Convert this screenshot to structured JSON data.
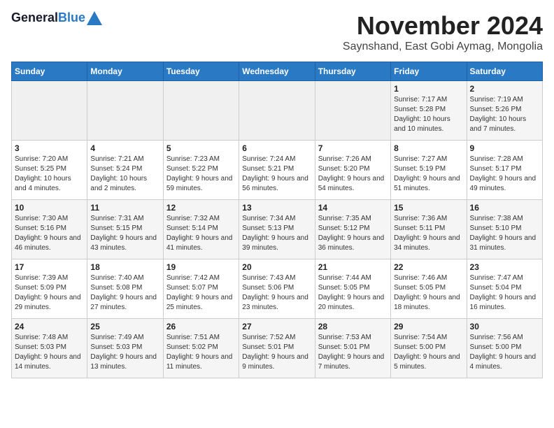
{
  "header": {
    "logo_line1": "General",
    "logo_line2": "Blue",
    "month_title": "November 2024",
    "location": "Saynshand, East Gobi Aymag, Mongolia"
  },
  "weekdays": [
    "Sunday",
    "Monday",
    "Tuesday",
    "Wednesday",
    "Thursday",
    "Friday",
    "Saturday"
  ],
  "weeks": [
    [
      {
        "day": "",
        "info": ""
      },
      {
        "day": "",
        "info": ""
      },
      {
        "day": "",
        "info": ""
      },
      {
        "day": "",
        "info": ""
      },
      {
        "day": "",
        "info": ""
      },
      {
        "day": "1",
        "info": "Sunrise: 7:17 AM\nSunset: 5:28 PM\nDaylight: 10 hours and 10 minutes."
      },
      {
        "day": "2",
        "info": "Sunrise: 7:19 AM\nSunset: 5:26 PM\nDaylight: 10 hours and 7 minutes."
      }
    ],
    [
      {
        "day": "3",
        "info": "Sunrise: 7:20 AM\nSunset: 5:25 PM\nDaylight: 10 hours and 4 minutes."
      },
      {
        "day": "4",
        "info": "Sunrise: 7:21 AM\nSunset: 5:24 PM\nDaylight: 10 hours and 2 minutes."
      },
      {
        "day": "5",
        "info": "Sunrise: 7:23 AM\nSunset: 5:22 PM\nDaylight: 9 hours and 59 minutes."
      },
      {
        "day": "6",
        "info": "Sunrise: 7:24 AM\nSunset: 5:21 PM\nDaylight: 9 hours and 56 minutes."
      },
      {
        "day": "7",
        "info": "Sunrise: 7:26 AM\nSunset: 5:20 PM\nDaylight: 9 hours and 54 minutes."
      },
      {
        "day": "8",
        "info": "Sunrise: 7:27 AM\nSunset: 5:19 PM\nDaylight: 9 hours and 51 minutes."
      },
      {
        "day": "9",
        "info": "Sunrise: 7:28 AM\nSunset: 5:17 PM\nDaylight: 9 hours and 49 minutes."
      }
    ],
    [
      {
        "day": "10",
        "info": "Sunrise: 7:30 AM\nSunset: 5:16 PM\nDaylight: 9 hours and 46 minutes."
      },
      {
        "day": "11",
        "info": "Sunrise: 7:31 AM\nSunset: 5:15 PM\nDaylight: 9 hours and 43 minutes."
      },
      {
        "day": "12",
        "info": "Sunrise: 7:32 AM\nSunset: 5:14 PM\nDaylight: 9 hours and 41 minutes."
      },
      {
        "day": "13",
        "info": "Sunrise: 7:34 AM\nSunset: 5:13 PM\nDaylight: 9 hours and 39 minutes."
      },
      {
        "day": "14",
        "info": "Sunrise: 7:35 AM\nSunset: 5:12 PM\nDaylight: 9 hours and 36 minutes."
      },
      {
        "day": "15",
        "info": "Sunrise: 7:36 AM\nSunset: 5:11 PM\nDaylight: 9 hours and 34 minutes."
      },
      {
        "day": "16",
        "info": "Sunrise: 7:38 AM\nSunset: 5:10 PM\nDaylight: 9 hours and 31 minutes."
      }
    ],
    [
      {
        "day": "17",
        "info": "Sunrise: 7:39 AM\nSunset: 5:09 PM\nDaylight: 9 hours and 29 minutes."
      },
      {
        "day": "18",
        "info": "Sunrise: 7:40 AM\nSunset: 5:08 PM\nDaylight: 9 hours and 27 minutes."
      },
      {
        "day": "19",
        "info": "Sunrise: 7:42 AM\nSunset: 5:07 PM\nDaylight: 9 hours and 25 minutes."
      },
      {
        "day": "20",
        "info": "Sunrise: 7:43 AM\nSunset: 5:06 PM\nDaylight: 9 hours and 23 minutes."
      },
      {
        "day": "21",
        "info": "Sunrise: 7:44 AM\nSunset: 5:05 PM\nDaylight: 9 hours and 20 minutes."
      },
      {
        "day": "22",
        "info": "Sunrise: 7:46 AM\nSunset: 5:05 PM\nDaylight: 9 hours and 18 minutes."
      },
      {
        "day": "23",
        "info": "Sunrise: 7:47 AM\nSunset: 5:04 PM\nDaylight: 9 hours and 16 minutes."
      }
    ],
    [
      {
        "day": "24",
        "info": "Sunrise: 7:48 AM\nSunset: 5:03 PM\nDaylight: 9 hours and 14 minutes."
      },
      {
        "day": "25",
        "info": "Sunrise: 7:49 AM\nSunset: 5:03 PM\nDaylight: 9 hours and 13 minutes."
      },
      {
        "day": "26",
        "info": "Sunrise: 7:51 AM\nSunset: 5:02 PM\nDaylight: 9 hours and 11 minutes."
      },
      {
        "day": "27",
        "info": "Sunrise: 7:52 AM\nSunset: 5:01 PM\nDaylight: 9 hours and 9 minutes."
      },
      {
        "day": "28",
        "info": "Sunrise: 7:53 AM\nSunset: 5:01 PM\nDaylight: 9 hours and 7 minutes."
      },
      {
        "day": "29",
        "info": "Sunrise: 7:54 AM\nSunset: 5:00 PM\nDaylight: 9 hours and 5 minutes."
      },
      {
        "day": "30",
        "info": "Sunrise: 7:56 AM\nSunset: 5:00 PM\nDaylight: 9 hours and 4 minutes."
      }
    ]
  ]
}
